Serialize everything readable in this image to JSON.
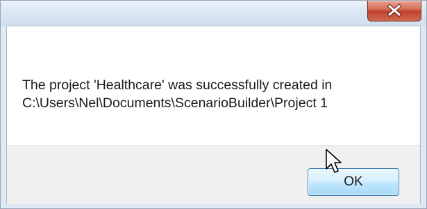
{
  "dialog": {
    "close_icon": "close-icon",
    "message_lines": [
      "The project 'Healthcare' was successfully created in",
      "C:\\Users\\Nel\\Documents\\ScenarioBuilder\\Project 1"
    ],
    "ok_label": "OK",
    "cursor_icon": "arrow-pointer-icon"
  },
  "colors": {
    "close_button": "#c7442e",
    "ok_button_border": "#3c7fb1",
    "footer_background": "#f0f0f0",
    "title_bar": "#dbe7f4"
  }
}
